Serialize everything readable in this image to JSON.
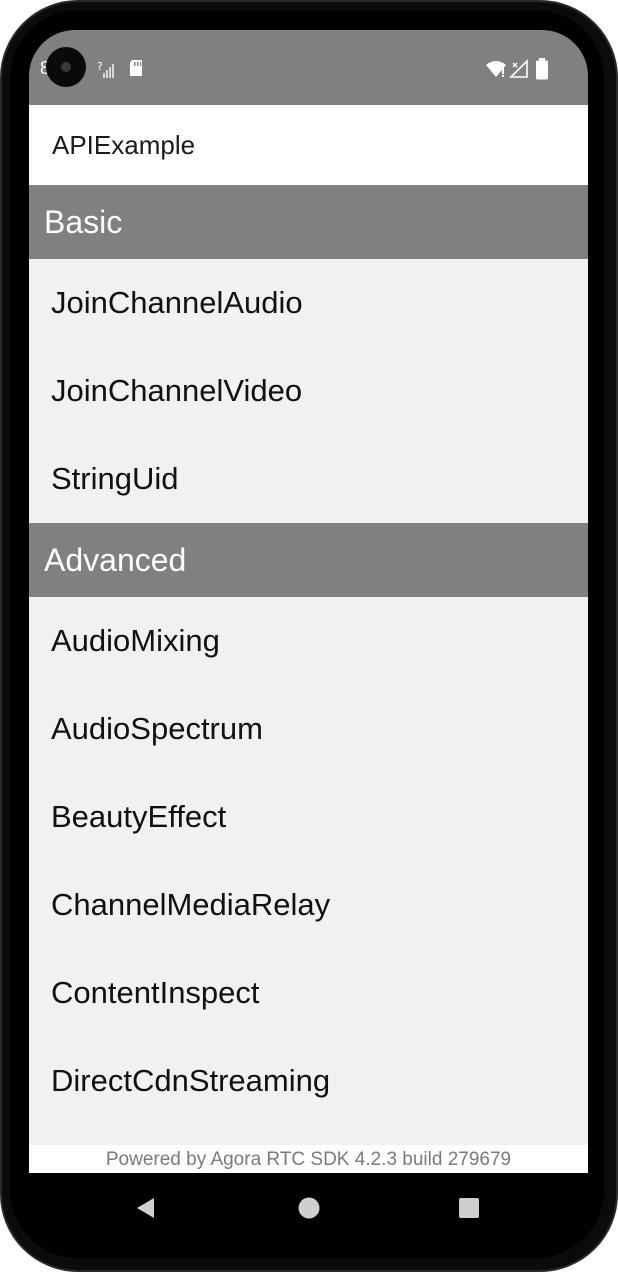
{
  "status_bar": {
    "time": "8",
    "icons": [
      "camera-punch-hole",
      "signal-unknown-icon",
      "sd-card-icon",
      "wifi-icon",
      "cell-signal-icon",
      "battery-icon"
    ]
  },
  "app_bar": {
    "title": "APIExample"
  },
  "sections": [
    {
      "header": "Basic",
      "items": [
        "JoinChannelAudio",
        "JoinChannelVideo",
        "StringUid"
      ]
    },
    {
      "header": "Advanced",
      "items": [
        "AudioMixing",
        "AudioSpectrum",
        "BeautyEffect",
        "ChannelMediaRelay",
        "ContentInspect",
        "DirectCdnStreaming"
      ]
    }
  ],
  "footer": {
    "text": "Powered by Agora RTC SDK 4.2.3 build 279679"
  },
  "nav_bar": {
    "buttons": [
      "back-icon",
      "home-icon",
      "recents-icon"
    ]
  },
  "colors": {
    "status_bar": "#808080",
    "section_header": "#808080",
    "list_background": "#f1f1f1",
    "app_bar": "#ffffff"
  }
}
